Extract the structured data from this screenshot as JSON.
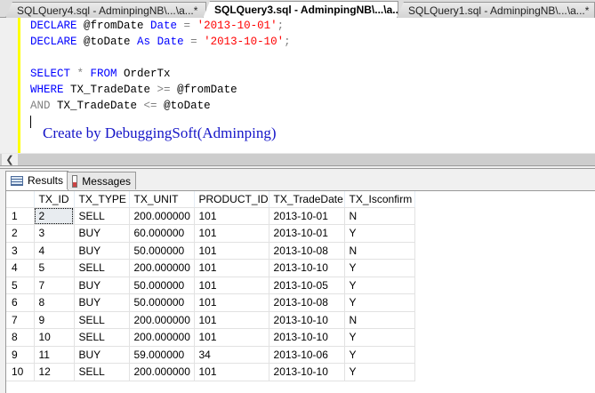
{
  "tabs": [
    {
      "label": "SQLQuery4.sql - AdminpingNB\\...\\a...*",
      "active": false
    },
    {
      "label": "SQLQuery3.sql - AdminpingNB\\...\\a...*",
      "active": true
    },
    {
      "label": "SQLQuery1.sql - AdminpingNB\\...\\a...*",
      "active": false
    }
  ],
  "editor": {
    "line1": {
      "kw1": "DECLARE",
      "var": " @fromDate ",
      "kw2": "Date",
      "op": " = ",
      "str": "'2013-10-01'",
      "end": ";"
    },
    "line2": {
      "kw1": "DECLARE",
      "var": " @toDate ",
      "kw2": "As",
      "kw3": "Date",
      "op": " = ",
      "str": "'2013-10-10'",
      "end": ";"
    },
    "line4": {
      "kw1": "SELECT",
      "op": " * ",
      "kw2": "FROM",
      "id": " OrderTx"
    },
    "line5": {
      "kw1": "WHERE",
      "id": " TX_TradeDate ",
      "op": ">=",
      "var": " @fromDate"
    },
    "line6": {
      "kw1": "AND",
      "id": " TX_TradeDate ",
      "op": "<=",
      "var": " @toDate"
    },
    "credit": "Create by DebuggingSoft(Adminping)"
  },
  "results_tabs": {
    "results": "Results",
    "messages": "Messages"
  },
  "grid": {
    "columns": [
      "TX_ID",
      "TX_TYPE",
      "TX_UNIT",
      "PRODUCT_ID",
      "TX_TradeDate",
      "TX_Isconfirm"
    ],
    "rows": [
      [
        "2",
        "SELL",
        "200.000000",
        "101",
        "2013-10-01",
        "N"
      ],
      [
        "3",
        "BUY",
        "60.000000",
        "101",
        "2013-10-01",
        "Y"
      ],
      [
        "4",
        "BUY",
        "50.000000",
        "101",
        "2013-10-08",
        "N"
      ],
      [
        "5",
        "SELL",
        "200.000000",
        "101",
        "2013-10-10",
        "Y"
      ],
      [
        "7",
        "BUY",
        "50.000000",
        "101",
        "2013-10-05",
        "Y"
      ],
      [
        "8",
        "BUY",
        "50.000000",
        "101",
        "2013-10-08",
        "Y"
      ],
      [
        "9",
        "SELL",
        "200.000000",
        "101",
        "2013-10-10",
        "N"
      ],
      [
        "10",
        "SELL",
        "200.000000",
        "101",
        "2013-10-10",
        "Y"
      ],
      [
        "11",
        "BUY",
        "59.000000",
        "34",
        "2013-10-06",
        "Y"
      ],
      [
        "12",
        "SELL",
        "200.000000",
        "101",
        "2013-10-10",
        "Y"
      ]
    ]
  }
}
